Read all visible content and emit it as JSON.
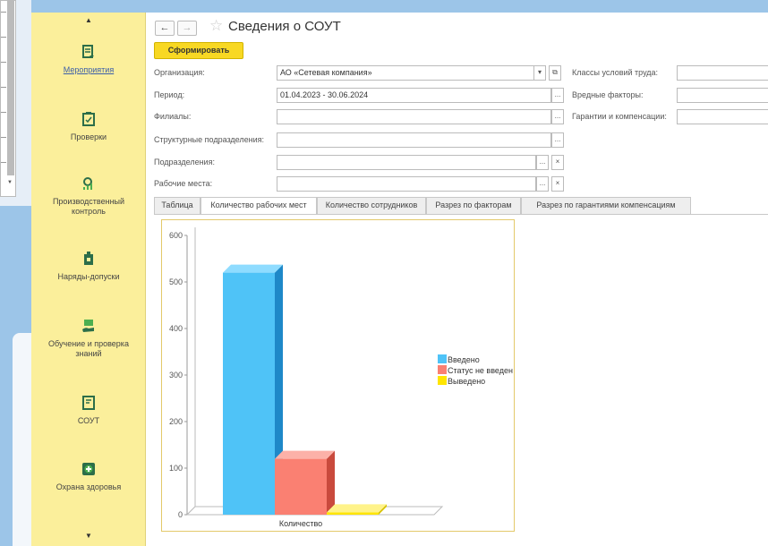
{
  "sidebar": {
    "items": [
      {
        "label": "Мероприятия",
        "icon": "events-icon",
        "link": true
      },
      {
        "label": "Проверки",
        "icon": "checks-icon",
        "link": false
      },
      {
        "label": "Производственный\nконтроль",
        "icon": "production-control-icon",
        "link": false
      },
      {
        "label": "Наряды-допуски",
        "icon": "work-permits-icon",
        "link": false
      },
      {
        "label": "Обучение и проверка\nзнаний",
        "icon": "training-icon",
        "link": false
      },
      {
        "label": "СОУТ",
        "icon": "sout-icon",
        "link": false
      },
      {
        "label": "Охрана здоровья",
        "icon": "health-icon",
        "link": false
      }
    ]
  },
  "header": {
    "back_icon": "←",
    "forward_icon": "→",
    "title": "Сведения о СОУТ"
  },
  "toolbar": {
    "generate_label": "Сформировать"
  },
  "form": {
    "organization_label": "Организация:",
    "organization_value": "АО «Сетевая компания»",
    "period_label": "Период:",
    "period_value": "01.04.2023 - 30.06.2024",
    "branches_label": "Филиалы:",
    "struct_units_label": "Структурные подразделения:",
    "units_label": "Подразделения:",
    "workplaces_label": "Рабочие места:",
    "work_classes_label": "Классы условий труда:",
    "harmful_factors_label": "Вредные факторы:",
    "guarantees_label": "Гарантии и компенсации:",
    "select_glyph": "...",
    "clear_glyph": "×",
    "dropdown_glyph": "▾",
    "open_glyph": "⧉"
  },
  "tabs": [
    "Таблица",
    "Количество рабочих мест",
    "Количество сотрудников",
    "Разрез по факторам",
    "Разрез по гарантиями компенсациям"
  ],
  "active_tab": 1,
  "colors": {
    "sidebar": "#fbef9b",
    "accent_button": "#f8d823",
    "series_entered": "#4fc3f7",
    "series_not_entered": "#fa8072",
    "series_removed": "#ffe500"
  },
  "chart_data": {
    "type": "bar",
    "categories": [
      "Количество"
    ],
    "series": [
      {
        "name": "Введено",
        "values": [
          520
        ]
      },
      {
        "name": "Статус не введен",
        "values": [
          120
        ]
      },
      {
        "name": "Выведено",
        "values": [
          5
        ]
      }
    ],
    "ylim": [
      0,
      600
    ],
    "yticks": [
      0,
      100,
      200,
      300,
      400,
      500,
      600
    ],
    "legend": "right",
    "three_d": true
  }
}
